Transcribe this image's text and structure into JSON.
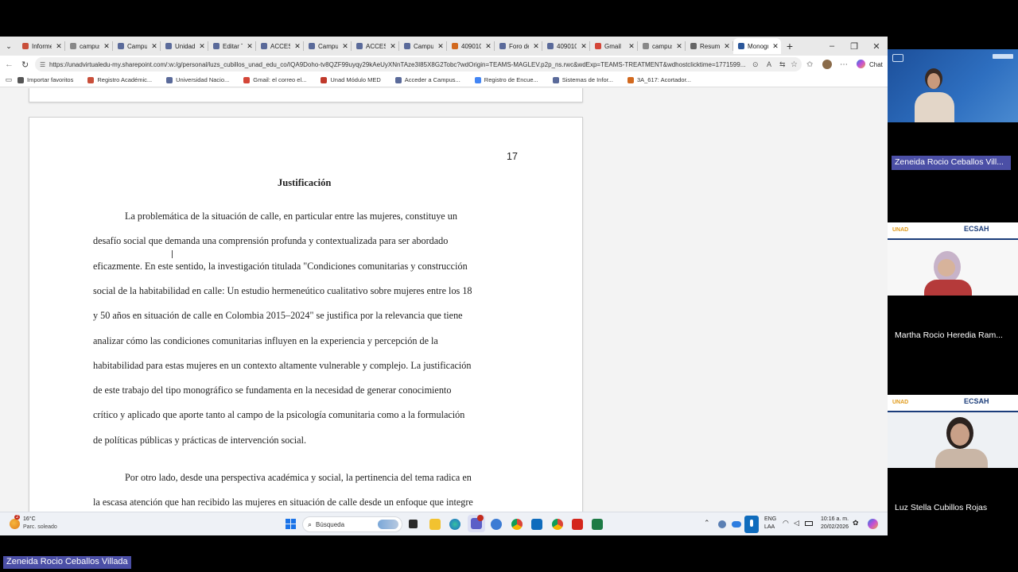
{
  "browser": {
    "tabs": [
      {
        "label": "Informe",
        "color": "#c94f3a"
      },
      {
        "label": "campus",
        "color": "#888888"
      },
      {
        "label": "Campus",
        "color": "#5a6a9a"
      },
      {
        "label": "Unidad",
        "color": "#5a6a9a"
      },
      {
        "label": "Editar Ta",
        "color": "#5a6a9a"
      },
      {
        "label": "ACCESIT",
        "color": "#5a6a9a"
      },
      {
        "label": "Campus",
        "color": "#5a6a9a"
      },
      {
        "label": "ACCESIT",
        "color": "#5a6a9a"
      },
      {
        "label": "Campus",
        "color": "#5a6a9a"
      },
      {
        "label": "409010A",
        "color": "#d2691e"
      },
      {
        "label": "Foro de",
        "color": "#5a6a9a"
      },
      {
        "label": "409010A",
        "color": "#5a6a9a"
      },
      {
        "label": "Gmail",
        "color": "#d44638"
      },
      {
        "label": "campus",
        "color": "#888888"
      },
      {
        "label": "Resume",
        "color": "#666666"
      },
      {
        "label": "Monogr",
        "color": "#2b579a"
      }
    ],
    "url": "https://unadvirtualedu-my.sharepoint.com/:w:/g/personal/luzs_cubillos_unad_edu_co/IQA9Doho-tv8QZF99uyqy29kAeUyXNnTAze3I85X8G2Tobc?wdOrigin=TEAMS-MAGLEV.p2p_ns.rwc&wdExp=TEAMS-TREATMENT&wdhostclicktime=1771599...",
    "chat_label": "Chat",
    "favorites": [
      {
        "label": "Importar favoritos",
        "color": "#555555"
      },
      {
        "label": "Registro Académic...",
        "color": "#c94f3a"
      },
      {
        "label": "Universidad Nacio...",
        "color": "#5a6a9a"
      },
      {
        "label": "Gmail: el correo el...",
        "color": "#d44638"
      },
      {
        "label": "Unad Módulo MED",
        "color": "#c0392b"
      },
      {
        "label": "Acceder a Campus...",
        "color": "#5a6a9a"
      },
      {
        "label": "Registro de Encue...",
        "color": "#4285f4"
      },
      {
        "label": "Sistemas de Infor...",
        "color": "#5a6a9a"
      },
      {
        "label": "3A_617: Acortador...",
        "color": "#d2691e"
      }
    ]
  },
  "document": {
    "page_number": "17",
    "heading": "Justificación",
    "lines": [
      "La problemática de la situación de calle, en particular entre las mujeres, constituye un",
      "desafío social que demanda una comprensión profunda y contextualizada para ser abordado",
      "eficazmente. En este sentido, la investigación titulada \"Condiciones comunitarias y construcción",
      "social de la habitabilidad en calle: Un estudio hermeneútico cualitativo sobre mujeres entre los 18",
      "y 50 años en situación de calle en Colombia 2015–2024\" se justifica por la relevancia que tiene",
      "analizar cómo las condiciones comunitarias influyen en la experiencia y percepción de la",
      "habitabilidad para estas mujeres en un contexto altamente vulnerable y complejo. La justificación",
      "de este trabajo del tipo monográfico se fundamenta en la necesidad de generar conocimiento",
      "crítico y aplicado que aporte tanto al campo de la psicología comunitaria como a la formulación",
      "de políticas públicas y prácticas de intervención social."
    ],
    "lines2": [
      "Por otro lado, desde una perspectiva académica y social, la pertinencia del tema radica en",
      "la escasa atención que han recibido las mujeres en situación de calle desde un enfoque que integre"
    ]
  },
  "taskbar": {
    "weather_temp": "16°C",
    "weather_desc": "Parc. soleado",
    "weather_badge": "2",
    "search_placeholder": "Búsqueda",
    "lang_top": "ENG",
    "lang_bottom": "LAA",
    "time": "10:16 a. m.",
    "date": "20/02/2026"
  },
  "participants": [
    {
      "name": "Zeneida Rocio Ceballos Vill...",
      "highlighted": true
    },
    {
      "name": "Martha Rocio Heredia Ram...",
      "highlighted": false
    },
    {
      "name": "Luz Stella Cubillos Rojas",
      "highlighted": false
    }
  ],
  "banner": {
    "brand": "ECSAH",
    "logo": "UNAD"
  },
  "presenter_name": "Zeneida Rocio Ceballos Villada",
  "colors": {
    "accent": "#4b4fa6",
    "teams_blue": "#2b579a"
  }
}
